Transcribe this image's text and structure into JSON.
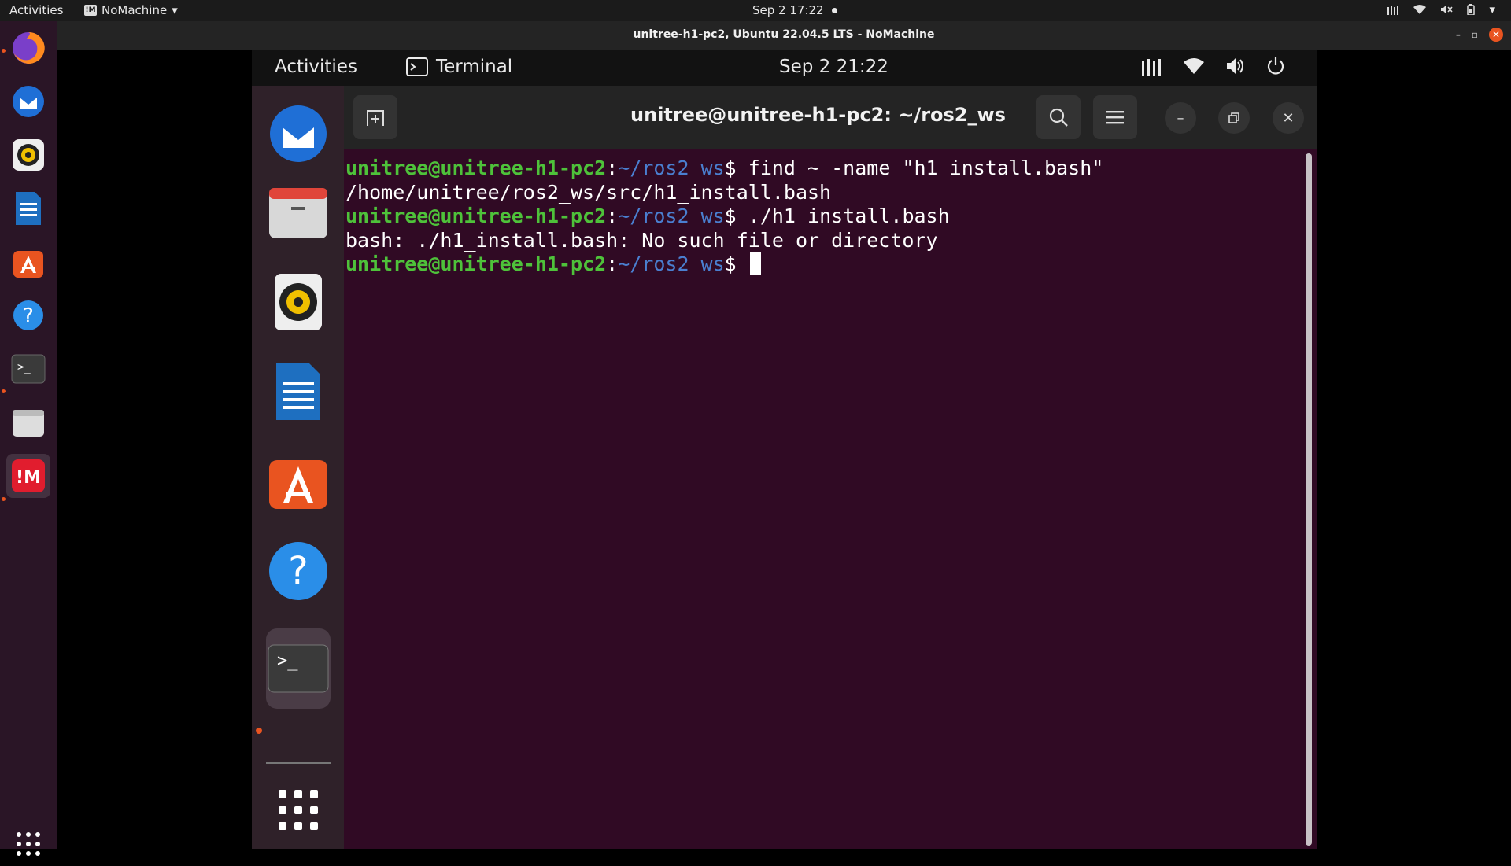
{
  "host": {
    "topbar": {
      "activities": "Activities",
      "app_name": "NoMachine",
      "clock": "Sep 2  17:22"
    },
    "dock_items": [
      "firefox-icon",
      "thunderbird-icon",
      "rhythmbox-icon",
      "writer-icon",
      "app-center-icon",
      "help-icon",
      "terminal-icon",
      "files-icon",
      "nomachine-icon",
      "show-apps-icon"
    ]
  },
  "nomachine": {
    "window_title": "unitree-h1-pc2, Ubuntu 22.04.5 LTS - NoMachine"
  },
  "remote": {
    "topbar": {
      "activities": "Activities",
      "app": "Terminal",
      "clock": "Sep 2  21:22"
    },
    "terminal": {
      "title": "unitree@unitree-h1-pc2: ~/ros2_ws",
      "lines": [
        {
          "user": "unitree@unitree-h1-pc2",
          "sep": ":",
          "path": "~/ros2_ws",
          "cmd": "$ find ~ -name \"h1_install.bash\""
        },
        {
          "output": "/home/unitree/ros2_ws/src/h1_install.bash"
        },
        {
          "user": "unitree@unitree-h1-pc2",
          "sep": ":",
          "path": "~/ros2_ws",
          "cmd": "$ ./h1_install.bash"
        },
        {
          "output": "bash: ./h1_install.bash: No such file or directory"
        },
        {
          "user": "unitree@unitree-h1-pc2",
          "sep": ":",
          "path": "~/ros2_ws",
          "cmd": "$ "
        }
      ]
    }
  },
  "colors": {
    "terminal_bg": "#300a24",
    "prompt_user": "#4ec23a",
    "prompt_path": "#4a7fd0",
    "accent": "#e95420"
  }
}
